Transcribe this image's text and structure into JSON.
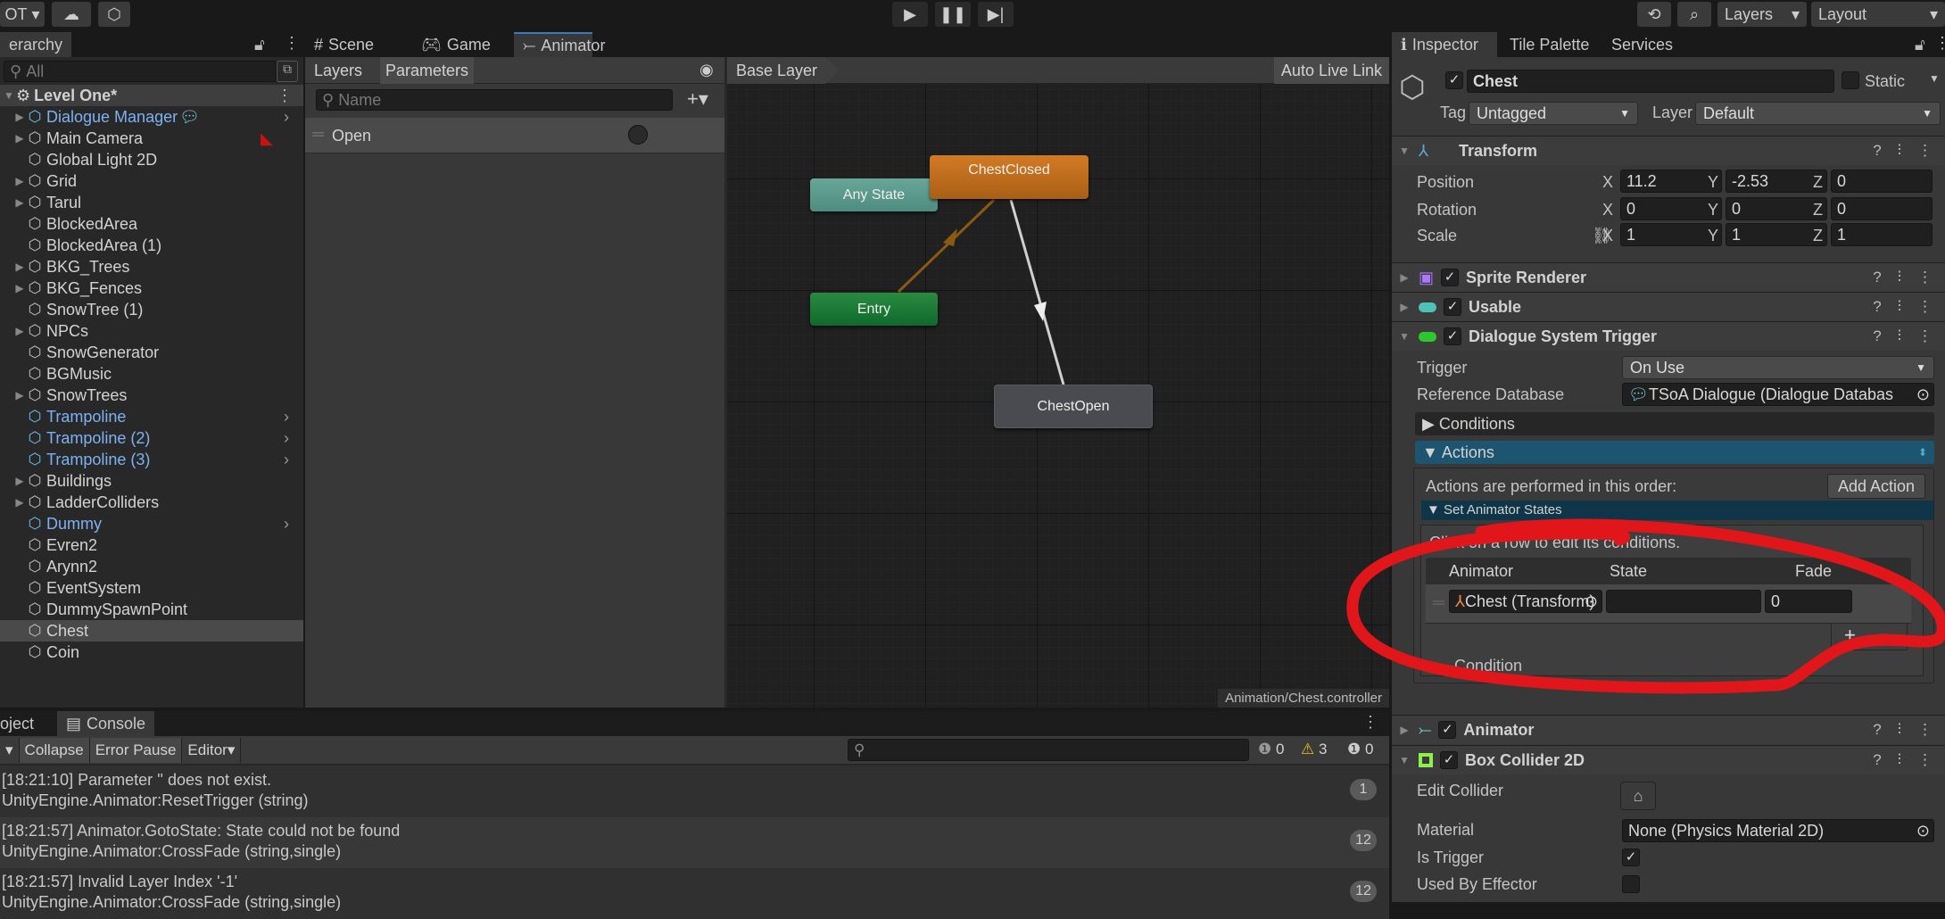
{
  "toolbar": {
    "account_label": "OT",
    "layers_label": "Layers",
    "layout_label": "Layout",
    "play_icon": "play-icon",
    "pause_icon": "pause-icon",
    "step_icon": "step-icon"
  },
  "hierarchy": {
    "tab_label": "erarchy",
    "search_placeholder": "All",
    "scene_name": "Level One*",
    "selected": "Chest",
    "items": [
      {
        "name": "Dialogue Manager",
        "expandable": true,
        "prefab": true,
        "chevron": true
      },
      {
        "name": "Main Camera",
        "expandable": true
      },
      {
        "name": "Global Light 2D"
      },
      {
        "name": "Grid",
        "expandable": true
      },
      {
        "name": "Tarul",
        "expandable": true
      },
      {
        "name": "BlockedArea"
      },
      {
        "name": "BlockedArea (1)"
      },
      {
        "name": "BKG_Trees",
        "expandable": true
      },
      {
        "name": "BKG_Fences",
        "expandable": true
      },
      {
        "name": "SnowTree (1)"
      },
      {
        "name": "NPCs",
        "expandable": true
      },
      {
        "name": "SnowGenerator"
      },
      {
        "name": "BGMusic"
      },
      {
        "name": "SnowTrees",
        "expandable": true
      },
      {
        "name": "Trampoline",
        "prefab": true,
        "chevron": true
      },
      {
        "name": "Trampoline (2)",
        "prefab": true,
        "chevron": true
      },
      {
        "name": "Trampoline (3)",
        "prefab": true,
        "chevron": true
      },
      {
        "name": "Buildings",
        "expandable": true
      },
      {
        "name": "LadderColliders",
        "expandable": true
      },
      {
        "name": "Dummy",
        "prefab": true,
        "chevron": true
      },
      {
        "name": "Evren2"
      },
      {
        "name": "Arynn2"
      },
      {
        "name": "EventSystem"
      },
      {
        "name": "DummySpawnPoint"
      },
      {
        "name": "Chest",
        "selected": true
      },
      {
        "name": "Coin"
      }
    ]
  },
  "center_tabs": {
    "scene": "Scene",
    "game": "Game",
    "animator": "Animator"
  },
  "animator": {
    "layers_tab": "Layers",
    "parameters_tab": "Parameters",
    "search_placeholder": "Name",
    "parameters": [
      {
        "name": "Open",
        "type": "trigger"
      }
    ],
    "breadcrumb": "Base Layer",
    "auto_live_link": "Auto Live Link",
    "footer_path": "Animation/Chest.controller",
    "states": {
      "any_state": "Any State",
      "entry": "Entry",
      "chest_closed": "ChestClosed",
      "chest_open": "ChestOpen"
    },
    "colors": {
      "any_state": "#5a9a8c",
      "entry": "#1f7a35",
      "default_state": "#c06e20",
      "state": "#4a4b50"
    }
  },
  "console": {
    "project_tab": "oject",
    "console_tab": "Console",
    "collapse": "Collapse",
    "error_pause": "Error Pause",
    "editor": "Editor",
    "counts": {
      "info": "0",
      "warning": "3",
      "error": "0"
    },
    "entries": [
      {
        "line1": "[18:21:10] Parameter '' does not exist.",
        "line2": "UnityEngine.Animator:ResetTrigger (string)",
        "count": "1"
      },
      {
        "line1": "[18:21:57] Animator.GotoState: State could not be found",
        "line2": "UnityEngine.Animator:CrossFade (string,single)",
        "count": "12"
      },
      {
        "line1": "[18:21:57] Invalid Layer Index '-1'",
        "line2": "UnityEngine.Animator:CrossFade (string,single)",
        "count": "12"
      }
    ]
  },
  "inspector": {
    "tabs": {
      "inspector": "Inspector",
      "tile_palette": "Tile Palette",
      "services": "Services"
    },
    "object_name": "Chest",
    "static_label": "Static",
    "tag_label": "Tag",
    "tag_value": "Untagged",
    "layer_label": "Layer",
    "layer_value": "Default",
    "transform": {
      "title": "Transform",
      "position_label": "Position",
      "rotation_label": "Rotation",
      "scale_label": "Scale",
      "position": {
        "x": "11.2",
        "y": "-2.53",
        "z": "0"
      },
      "rotation": {
        "x": "0",
        "y": "0",
        "z": "0"
      },
      "scale": {
        "x": "1",
        "y": "1",
        "z": "1"
      },
      "axis_x": "X",
      "axis_y": "Y",
      "axis_z": "Z"
    },
    "sprite_renderer": "Sprite Renderer",
    "usable": "Usable",
    "dst": {
      "title": "Dialogue System Trigger",
      "trigger_label": "Trigger",
      "trigger_value": "On Use",
      "refdb_label": "Reference Database",
      "refdb_value": "TSoA Dialogue (Dialogue Databas",
      "conditions": "Conditions",
      "actions": "Actions",
      "actions_order": "Actions are performed in this order:",
      "add_action": "Add Action",
      "set_animator_states": "Set Animator States",
      "click_row": "Click on a row to edit its conditions.",
      "col_animator": "Animator",
      "col_state": "State",
      "col_fade": "Fade",
      "row_animator": "Chest (Transform)",
      "row_state": "",
      "row_fade": "0",
      "condition": "Condition"
    },
    "animator_comp": "Animator",
    "box_collider": {
      "title": "Box Collider 2D",
      "edit_collider": "Edit Collider",
      "material_label": "Material",
      "material_value": "None (Physics Material 2D)",
      "is_trigger": "Is Trigger",
      "is_trigger_checked": true,
      "used_by_effector": "Used By Effector",
      "used_by_effector_checked": false
    }
  },
  "annotation_color": "#e0161b"
}
